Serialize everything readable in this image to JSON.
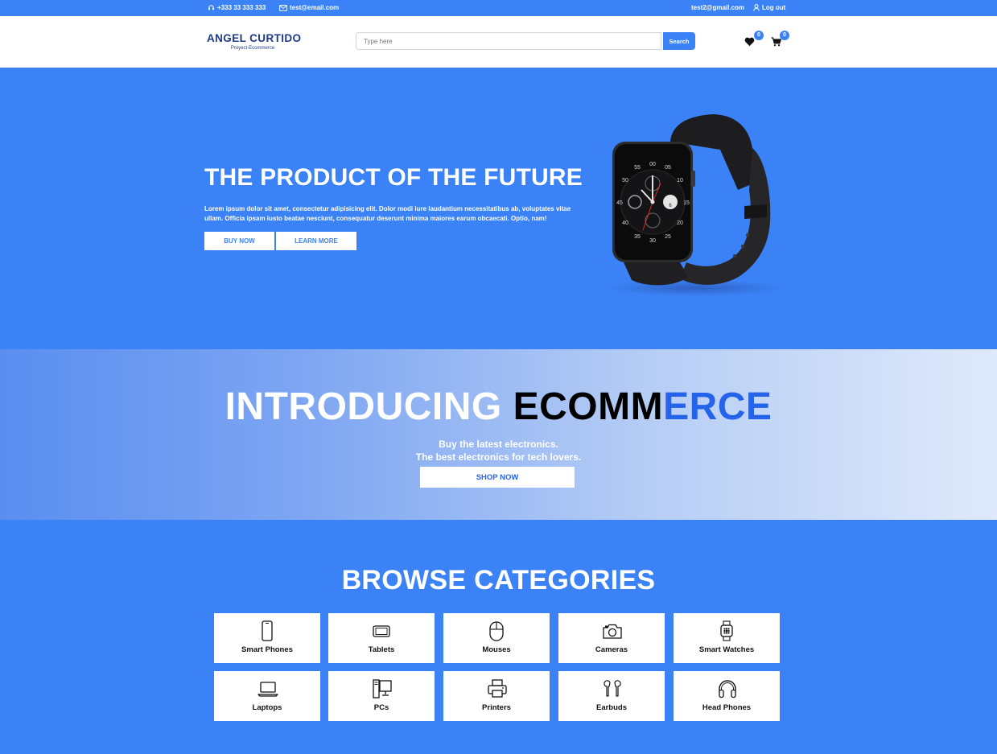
{
  "topbar": {
    "phone": "+333 33 333 333",
    "email": "test@email.com",
    "user_email": "test2@gmail.com",
    "logout_label": "Log out"
  },
  "header": {
    "logo_title": "ANGEL CURTIDO",
    "logo_subtitle": "Proyect-Ecommerce",
    "search_placeholder": "Type here",
    "search_button": "Search",
    "wishlist_count": "0",
    "cart_count": "0"
  },
  "hero": {
    "title": "THE PRODUCT OF THE FUTURE",
    "text": "Lorem ipsum dolor sit amet, consectetur adipisicing elit. Dolor modi iure laudantium necessitatibus ab, voluptates vitae ullam. Officia ipsam iusto beatae nesciunt, consequatur deserunt minima maiores earum obcaecati. Optio, nam!",
    "buy_now": "BUY NOW",
    "learn_more": "LEARN MORE",
    "watch_labels": {
      "top": "00",
      "left": "45",
      "right": "15",
      "bottom": "30",
      "n05": "05",
      "n10": "10",
      "n20": "20",
      "n25": "25",
      "n35": "35",
      "n40": "40",
      "n50": "50",
      "n55": "55",
      "date": "6"
    }
  },
  "intro": {
    "title_part1": "INTRODUCING",
    "title_part2": "ECOMM",
    "title_part3": "ERCE",
    "line1": "Buy the latest electronics.",
    "line2": "The best electronics for tech lovers.",
    "shop_now": "SHOP NOW"
  },
  "categories": {
    "title": "BROWSE CATEGORIES",
    "items": [
      {
        "label": "Smart Phones",
        "icon": "smartphone-icon"
      },
      {
        "label": "Tablets",
        "icon": "tablet-icon"
      },
      {
        "label": "Mouses",
        "icon": "mouse-icon"
      },
      {
        "label": "Cameras",
        "icon": "camera-icon"
      },
      {
        "label": "Smart Watches",
        "icon": "smartwatch-icon"
      },
      {
        "label": "Laptops",
        "icon": "laptop-icon"
      },
      {
        "label": "PCs",
        "icon": "pc-icon"
      },
      {
        "label": "Printers",
        "icon": "printer-icon"
      },
      {
        "label": "Earbuds",
        "icon": "earbuds-icon"
      },
      {
        "label": "Head Phones",
        "icon": "headphones-icon"
      }
    ]
  },
  "colors": {
    "primary": "#3b82f6",
    "accent_blue": "#2563eb",
    "logo_navy": "#1e3a8a",
    "white": "#ffffff"
  }
}
